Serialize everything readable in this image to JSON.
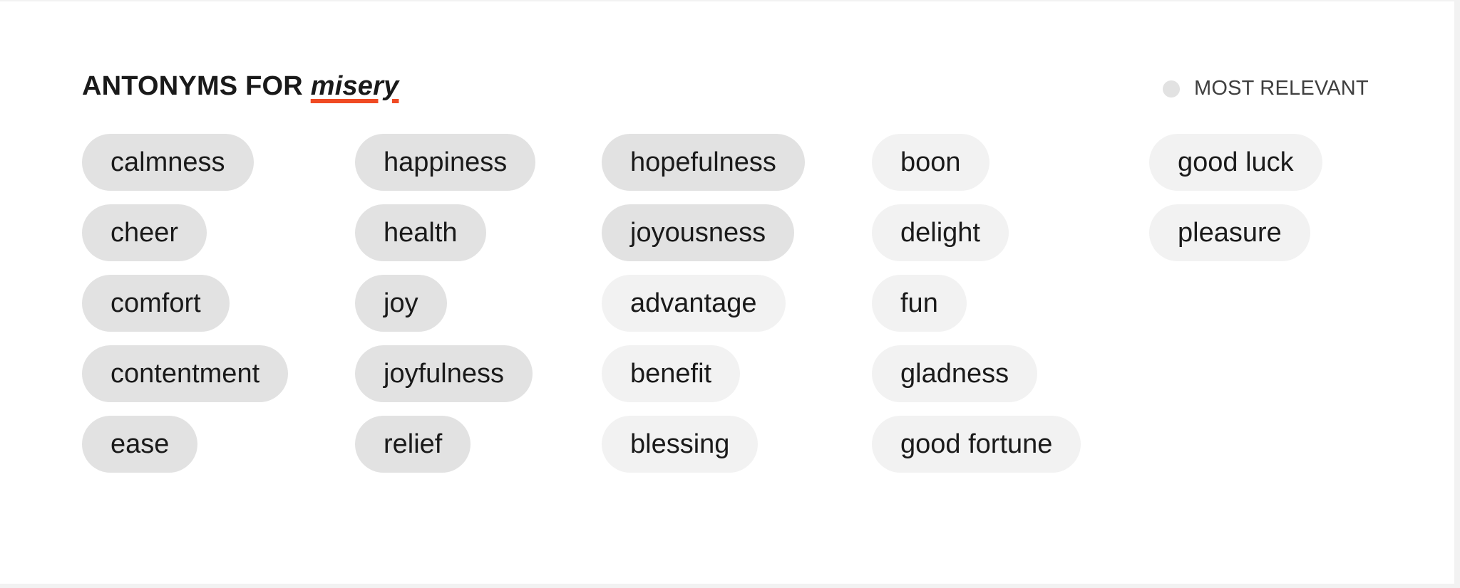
{
  "header": {
    "prefix": "ANTONYMS FOR",
    "word": "misery"
  },
  "legend": {
    "label": "MOST RELEVANT"
  },
  "colors": {
    "underline": "#f04a23",
    "most_relevant_pill": "#e2e2e2",
    "less_relevant_pill": "#f2f2f2"
  },
  "columns": [
    {
      "items": [
        {
          "label": "calmness",
          "relevance": "most"
        },
        {
          "label": "cheer",
          "relevance": "most"
        },
        {
          "label": "comfort",
          "relevance": "most"
        },
        {
          "label": "contentment",
          "relevance": "most"
        },
        {
          "label": "ease",
          "relevance": "most"
        }
      ]
    },
    {
      "items": [
        {
          "label": "happiness",
          "relevance": "most"
        },
        {
          "label": "health",
          "relevance": "most"
        },
        {
          "label": "joy",
          "relevance": "most"
        },
        {
          "label": "joyfulness",
          "relevance": "most"
        },
        {
          "label": "relief",
          "relevance": "most"
        }
      ]
    },
    {
      "items": [
        {
          "label": "hopefulness",
          "relevance": "most"
        },
        {
          "label": "joyousness",
          "relevance": "most"
        },
        {
          "label": "advantage",
          "relevance": "less"
        },
        {
          "label": "benefit",
          "relevance": "less"
        },
        {
          "label": "blessing",
          "relevance": "less"
        }
      ]
    },
    {
      "items": [
        {
          "label": "boon",
          "relevance": "less"
        },
        {
          "label": "delight",
          "relevance": "less"
        },
        {
          "label": "fun",
          "relevance": "less"
        },
        {
          "label": "gladness",
          "relevance": "less"
        },
        {
          "label": "good fortune",
          "relevance": "less"
        }
      ]
    },
    {
      "items": [
        {
          "label": "good luck",
          "relevance": "less"
        },
        {
          "label": "pleasure",
          "relevance": "less"
        }
      ]
    }
  ]
}
